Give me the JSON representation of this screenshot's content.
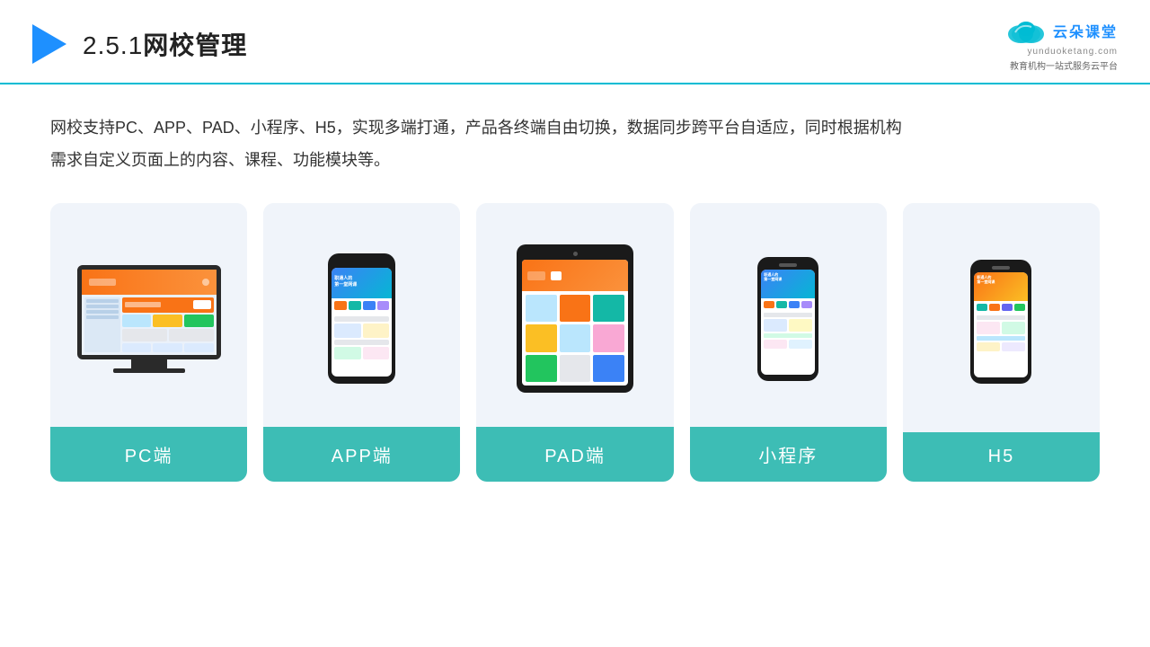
{
  "header": {
    "title": "2.5.1网校管理",
    "title_prefix": "2.5.1",
    "title_main": "网校管理"
  },
  "logo": {
    "name_cn": "云朵课堂",
    "name_en": "yunduoketang.com",
    "slogan": "教育机构一站\n式服务云平台"
  },
  "description": "网校支持PC、APP、PAD、小程序、H5，实现多端打通，产品各终端自由切换，数据同步跨平台自适应，同时根据机构\n需求自定义页面上的内容、课程、功能模块等。",
  "cards": [
    {
      "id": "pc",
      "label": "PC端"
    },
    {
      "id": "app",
      "label": "APP端"
    },
    {
      "id": "pad",
      "label": "PAD端"
    },
    {
      "id": "miniapp",
      "label": "小程序"
    },
    {
      "id": "h5",
      "label": "H5"
    }
  ]
}
